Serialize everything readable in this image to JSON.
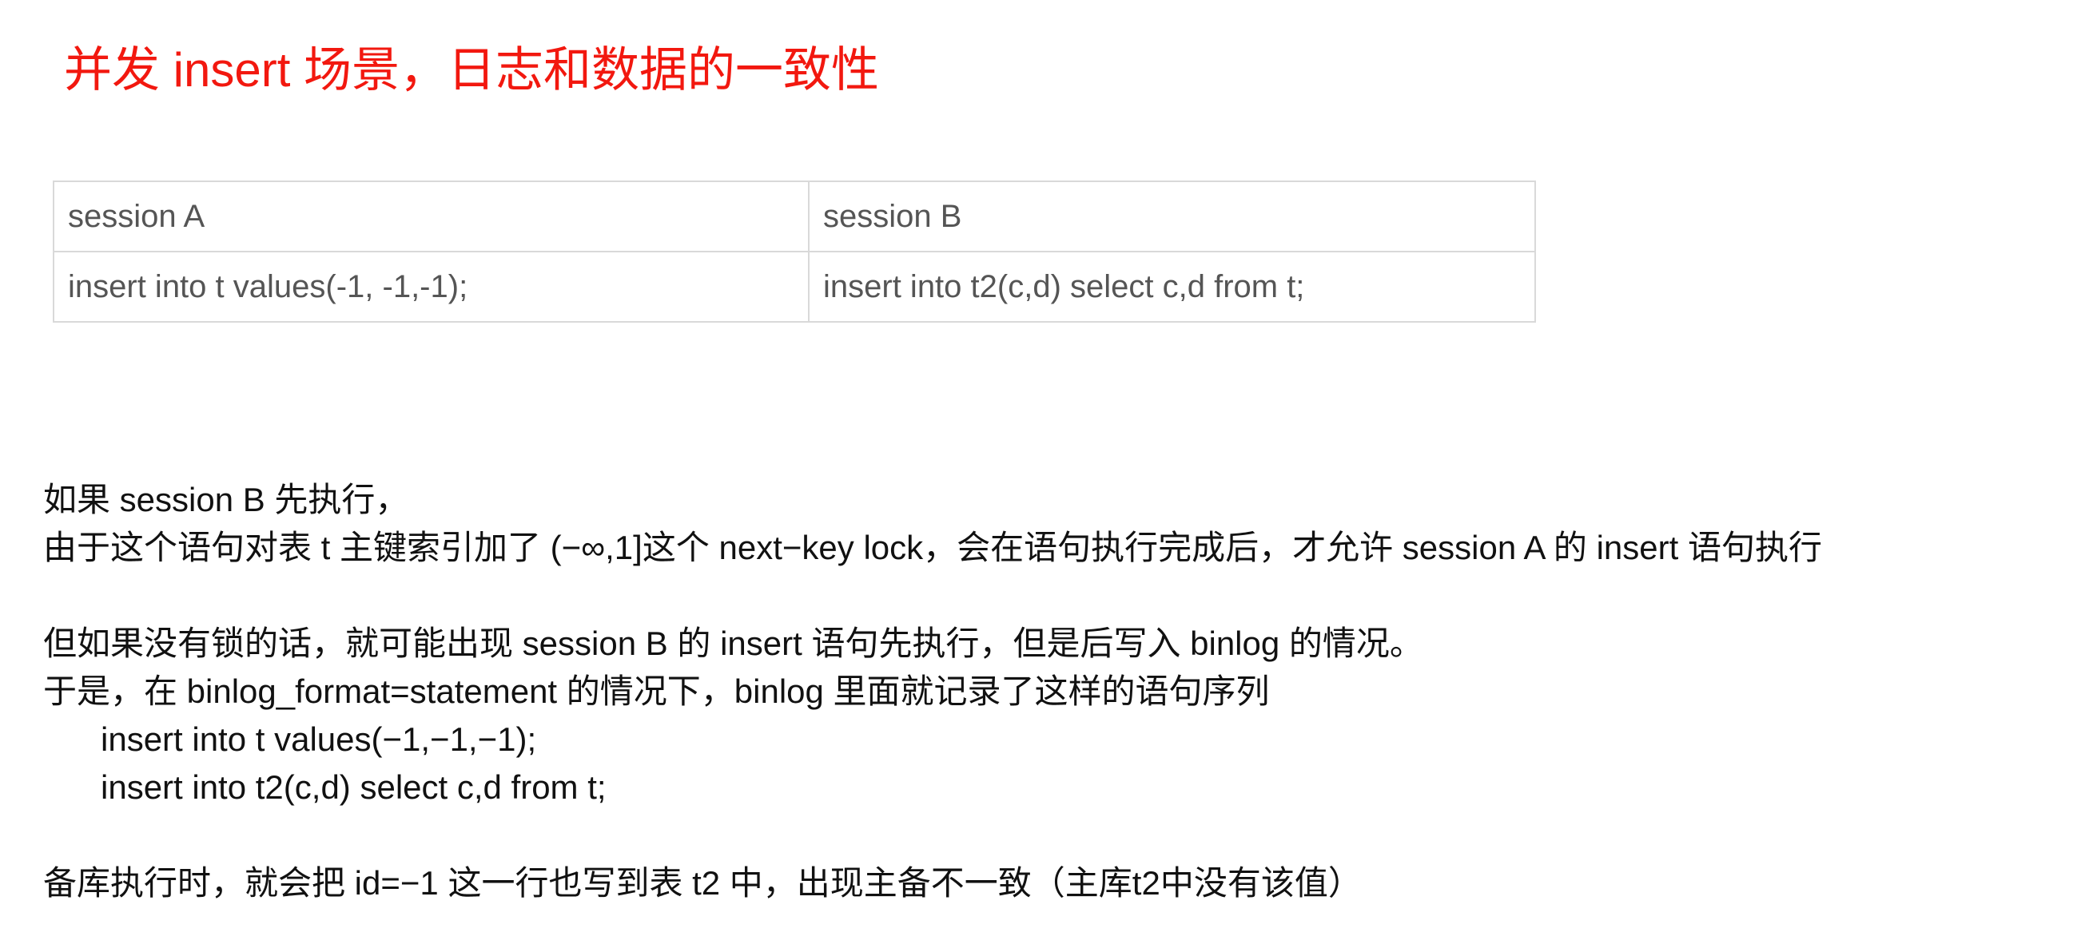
{
  "title": "并发 insert 场景，日志和数据的一致性",
  "table": {
    "headers": [
      "session A",
      "session B"
    ],
    "rows": [
      [
        "insert into t values(-1, -1,-1);",
        "insert into t2(c,d) select c,d from t;"
      ]
    ]
  },
  "body": {
    "p1_line1": "如果 session B 先执行，",
    "p1_line2": "由于这个语句对表 t 主键索引加了 (−∞,1]这个 next−key lock，会在语句执行完成后，才允许 session A 的 insert 语句执行",
    "p2_line1": "但如果没有锁的话，就可能出现 session B 的 insert 语句先执行，但是后写入 binlog 的情况。",
    "p2_line2": "于是，在 binlog_format=statement 的情况下，binlog 里面就记录了这样的语句序列",
    "code_line1": "insert into t values(−1,−1,−1);",
    "code_line2": "insert into t2(c,d) select c,d from t;",
    "p3_line1": "备库执行时，就会把 id=−1 这一行也写到表 t2 中，出现主备不一致（主库t2中没有该值）"
  }
}
